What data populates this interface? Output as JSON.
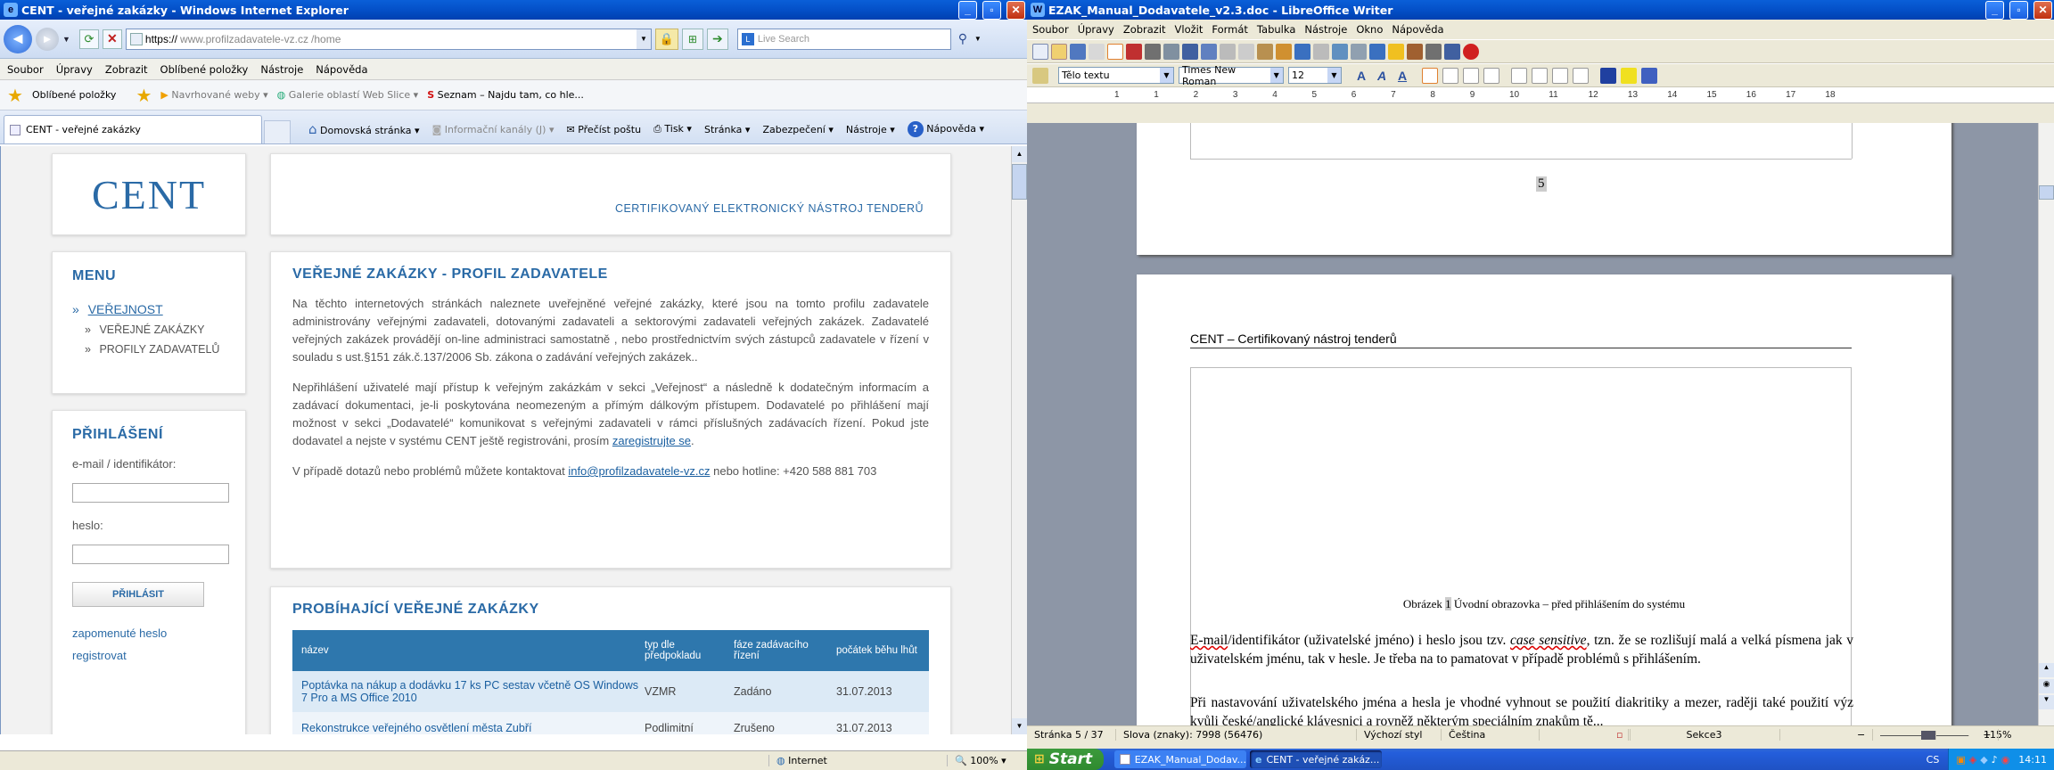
{
  "ie": {
    "title": "CENT - veřejné zakázky - Windows Internet Explorer",
    "address_proto": "https://",
    "address_host": "www.profilzadavatele-vz.cz",
    "address_path": "/home",
    "search_placeholder": "Live Search",
    "menu": [
      "Soubor",
      "Úpravy",
      "Zobrazit",
      "Oblíbené položky",
      "Nástroje",
      "Nápověda"
    ],
    "favorites_label": "Oblíbené položky",
    "favs": [
      "Navrhované weby",
      "Galerie oblastí Web Slice",
      "Seznam – Najdu tam, co hle..."
    ],
    "tab_label": "CENT - veřejné zakázky",
    "cmd": [
      "Domovská stránka",
      "Informační kanály (J)",
      "Přečíst poštu",
      "Tisk",
      "Stránka",
      "Zabezpečení",
      "Nástroje",
      "Nápověda"
    ],
    "status_zone": "Internet",
    "status_zoom": "100%"
  },
  "site": {
    "logo": "CENT",
    "tagline": "CERTIFIKOVANÝ ELEKTRONICKÝ NÁSTROJ TENDERŮ",
    "menu_title": "MENU",
    "menu_main": "VEŘEJNOST",
    "menu_sub": [
      "VEŘEJNÉ ZAKÁZKY",
      "PROFILY ZADAVATELŮ"
    ],
    "login_title": "PŘIHLÁŠENÍ",
    "login_email_label": "e-mail / identifikátor:",
    "login_pass_label": "heslo:",
    "login_button": "PŘIHLÁSIT",
    "forgot": "zapomenuté heslo",
    "register": "registrovat",
    "main_title": "VEŘEJNÉ ZAKÁZKY - PROFIL ZADAVATELE",
    "p1": "Na těchto internetových stránkách naleznete uveřejněné veřejné zakázky, které jsou na tomto profilu zadavatele administrovány veřejnými zadavateli, dotovanými zadavateli a sektorovými zadavateli veřejných zakázek. Zadavatelé veřejných zakázek provádějí on-line administraci samostatně , nebo prostřednictvím svých zástupců zadavatele v řízení v souladu s ust.§151 zák.č.137/2006 Sb. zákona o zadávání veřejných zakázek..",
    "p2": "Nepřihlášení uživatelé mají přístup k veřejným zakázkám v sekci „Veřejnost“ a následně k dodatečným informacím a zadávací dokumentaci, je-li poskytována neomezeným a přímým dálkovým přístupem. Dodavatelé po přihlášení mají možnost v sekci „Dodavatelé“ komunikovat s veřejnými zadavateli v rámci příslušných zadávacích řízení. Pokud jste dodavatel a nejste v systému CENT ještě registrováni, prosím",
    "p2_link": "zaregistrujte se",
    "p2_end": ".",
    "p3_start": "V případě dotazů nebo problémů můžete kontaktovat",
    "p3_email": "info@profilzadavatele-vz.cz",
    "p3_end": "nebo hotline: +420 588 881 703",
    "table_title": "PROBÍHAJÍCÍ VEŘEJNÉ ZAKÁZKY",
    "table_headers": [
      "název",
      "typ dle předpokladu",
      "fáze zadávacího řízení",
      "počátek běhu lhůt"
    ],
    "rows": [
      {
        "name": "Poptávka na nákup a dodávku 17 ks PC sestav včetně OS Windows 7 Pro a MS Office 2010",
        "type": "VZMR",
        "phase": "Zadáno",
        "date": "31.07.2013"
      },
      {
        "name": "Rekonstrukce veřejného osvětlení města Zubří",
        "type": "Podlimitní",
        "phase": "Zrušeno",
        "date": "31.07.2013"
      }
    ]
  },
  "lo": {
    "title": "EZAK_Manual_Dodavatele_v2.3.doc - LibreOffice Writer",
    "menu": [
      "Soubor",
      "Úpravy",
      "Zobrazit",
      "Vložit",
      "Formát",
      "Tabulka",
      "Nástroje",
      "Okno",
      "Nápověda"
    ],
    "style": "Tělo textu",
    "font": "Times New Roman",
    "size": "12",
    "ruler": [
      "1",
      "1",
      "2",
      "3",
      "4",
      "5",
      "6",
      "7",
      "8",
      "9",
      "10",
      "11",
      "12",
      "13",
      "14",
      "15",
      "16",
      "17",
      "18"
    ],
    "page_number": "5",
    "header_text": "CENT – Certifikovaný nástroj tenderů",
    "caption_pre": "Obrázek",
    "caption_num": "1",
    "caption_post": "Úvodní obrazovka – před přihlášením do systému",
    "body1_a": "E-mail",
    "body1_b": "/identifikátor (uživatelské jméno) i heslo jsou tzv.",
    "body1_term": "case sensitive",
    "body1_c": ", tzn. že se rozlišují malá a velká písmena jak v uživatelském jménu, tak v hesle. Je třeba na to pamatovat v případě problémů s přihlášením.",
    "body2": "Při nastavování uživatelského jména a hesla je vhodné vyhnout se použití diakritiky a mezer, raději také použití výz kvůli české/anglické klávesnici a rovněž některým speciálním znakům tě...",
    "status": [
      "Stránka 5 / 37",
      "Slova (znaky): 7998 (56476)",
      "Výchozí styl",
      "Čeština",
      "",
      "Sekce3"
    ],
    "zoom": "115%"
  },
  "taskbar": {
    "start": "Start",
    "tasks": [
      "EZAK_Manual_Dodav...",
      "CENT - veřejné zakáz..."
    ],
    "lang": "CS",
    "time": "14:11"
  },
  "colors": {
    "ie_header": "#dfe9f7",
    "site_blue": "#2a6aa6",
    "table_head": "#2e77ad",
    "table_row": "#dceaf6",
    "xp_blue": "#0450c8"
  }
}
